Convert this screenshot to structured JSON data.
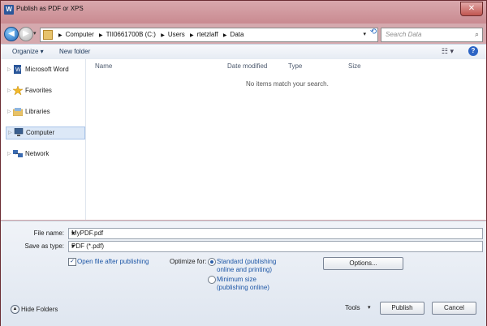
{
  "window": {
    "title": "Publish as PDF or XPS",
    "app_icon_text": "W",
    "close_glyph": "✕"
  },
  "navigation": {
    "back_glyph": "◀",
    "forward_glyph": "▶",
    "recent_glyph": "▾",
    "breadcrumbs": [
      "Computer",
      "TII0661700B (C:)",
      "Users",
      "rtetzlaff",
      "Data"
    ],
    "dropdown_glyph": "▾",
    "refresh_glyph": "⟲",
    "search_placeholder": "Search Data",
    "search_glyph": "⌕"
  },
  "toolbar": {
    "organize_label": "Organize ▾",
    "new_folder_label": "New folder",
    "view_glyph": "☷ ▾",
    "help_glyph": "?"
  },
  "sidebar": {
    "items": [
      {
        "label": "Microsoft Word",
        "icon": "word-doc-icon"
      },
      {
        "label": "Favorites",
        "icon": "star-icon"
      },
      {
        "label": "Libraries",
        "icon": "library-icon"
      },
      {
        "label": "Computer",
        "icon": "computer-icon",
        "selected": true
      },
      {
        "label": "Network",
        "icon": "network-icon"
      }
    ]
  },
  "file_list": {
    "columns": [
      "Name",
      "Date modified",
      "Type",
      "Size"
    ],
    "empty_message": "No items match your search."
  },
  "form": {
    "file_name_label": "File name:",
    "file_name_value": "MyPDF.pdf",
    "save_type_label": "Save as type:",
    "save_type_value": "PDF (*.pdf)",
    "open_after_label": "Open file after publishing",
    "open_after_checked": true,
    "optimize_label": "Optimize for:",
    "standard_label_1": "Standard (publishing",
    "standard_label_2": "online and printing)",
    "minimum_label_1": "Minimum size",
    "minimum_label_2": "(publishing online)",
    "options_label": "Options..."
  },
  "footer": {
    "hide_folders_label": "Hide Folders",
    "hide_folders_glyph": "▲",
    "tools_label": "Tools",
    "tools_glyph": "▾",
    "publish_label": "Publish",
    "cancel_label": "Cancel"
  },
  "colors": {
    "title_bar": "#c98a91",
    "accent": "#2b5ea8",
    "link": "#1e57a6"
  }
}
